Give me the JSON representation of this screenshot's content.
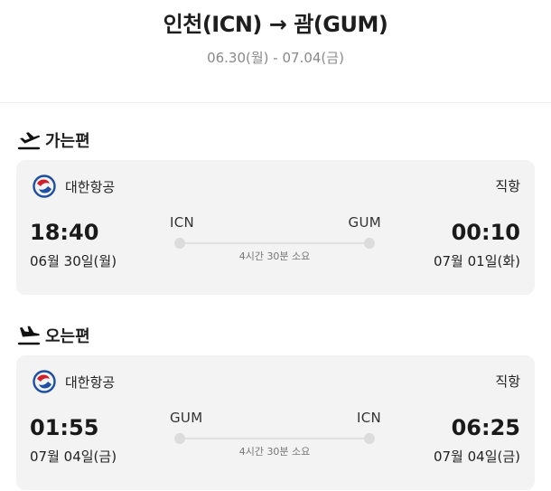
{
  "header": {
    "route": "인천(ICN) → 괌(GUM)",
    "dates": "06.30(월) - 07.04(금)"
  },
  "outbound": {
    "section_label": "가는편",
    "icon": "airplane-takeoff-icon",
    "airline": "대한항공",
    "airline_logo": "korean-air-logo",
    "flight_type": "직항",
    "dep_time": "18:40",
    "dep_date": "06월 30일(월)",
    "dep_code": "ICN",
    "arr_time": "00:10",
    "arr_date": "07월 01일(화)",
    "arr_code": "GUM",
    "duration": "4시간 30분 소요"
  },
  "inbound": {
    "section_label": "오는편",
    "icon": "airplane-landing-icon",
    "airline": "대한항공",
    "airline_logo": "korean-air-logo",
    "flight_type": "직항",
    "dep_time": "01:55",
    "dep_date": "07월 04일(금)",
    "dep_code": "GUM",
    "arr_time": "06:25",
    "arr_date": "07월 04일(금)",
    "arr_code": "ICN",
    "duration": "4시간 30분 소요"
  },
  "colors": {
    "card_bg": "#f3f3f3",
    "logo_blue": "#1f4fa0",
    "logo_red": "#d0212b"
  }
}
